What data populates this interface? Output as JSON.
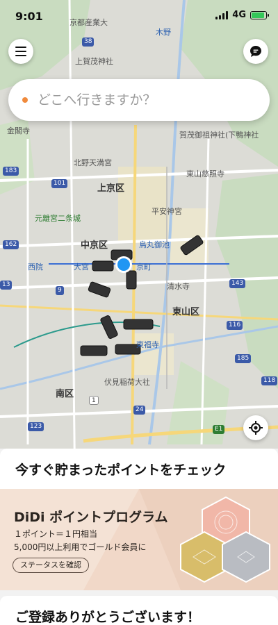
{
  "status_bar": {
    "time": "9:01",
    "network": "4G",
    "battery_level": 0.9
  },
  "search": {
    "placeholder": "どこへ行きますか？"
  },
  "map": {
    "labels": {
      "kyoto_sangyo": "京都産業大",
      "kino": "木野",
      "kamigamo": "上賀茂神社",
      "kinkakuji": "金閣寺",
      "kamomioya": "賀茂御祖神社(下鴨神社",
      "kitano": "北野天満宮",
      "higashiyama_jisho": "東山慈照寺",
      "kamigyo": "上京区",
      "heian": "平安神宮",
      "motorikyu": "元離宮二条城",
      "nakagyo": "中京区",
      "karasuma_oike": "烏丸御池",
      "nishiin": "西院",
      "omiya": "大宮",
      "kyoto_shiyakusho": "京町",
      "kiyomizu": "清水寺",
      "higashiyama": "東山区",
      "tofukuji": "東福寺",
      "fushimi": "伏見稲荷大社",
      "minami": "南区"
    },
    "shields": [
      "38",
      "183",
      "101",
      "162",
      "13",
      "9",
      "116",
      "143",
      "185",
      "118",
      "1",
      "24",
      "123",
      "E1"
    ]
  },
  "panel": {
    "title": "今すぐ貯まったポイントをチェック",
    "promo_heading": "DiDi ポイントプログラム",
    "promo_line1": "１ポイント＝１円相当",
    "promo_line2": "5,000円以上利用でゴールド会員に",
    "promo_button": "ステータスを確認",
    "second_title": "ご登録ありがとうございます！"
  },
  "colors": {
    "accent": "#f08a3c",
    "location": "#2196f3"
  },
  "icons": {
    "menu": "menu-icon",
    "message": "message-icon",
    "locate": "locate-icon"
  }
}
